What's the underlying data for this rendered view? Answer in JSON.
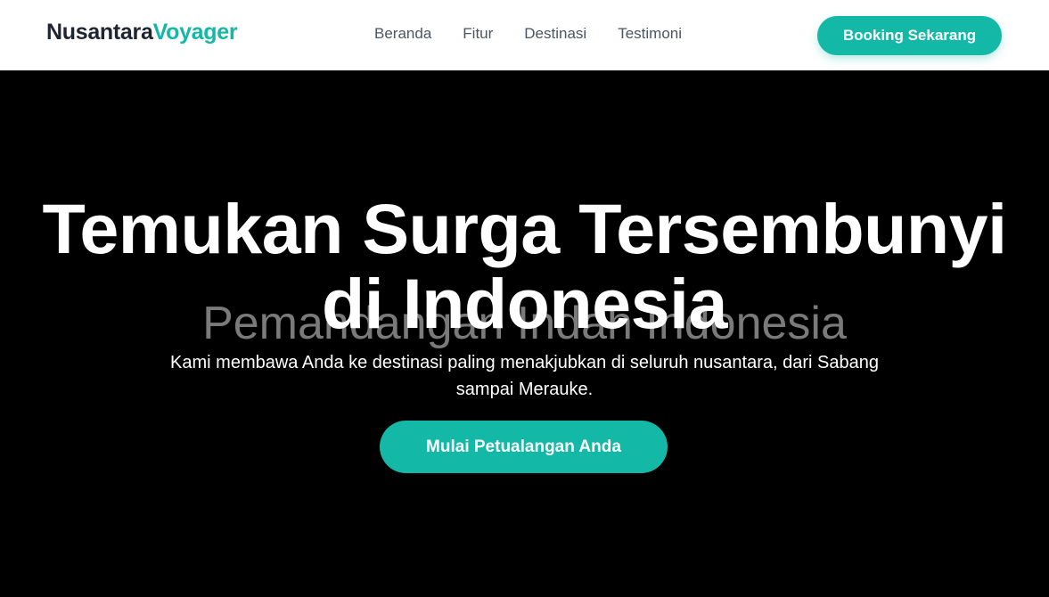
{
  "colors": {
    "accent": "#14b8a6",
    "logo_dark": "#1f2433",
    "nav_text": "#4b5563",
    "hero_bg": "#000000"
  },
  "navbar": {
    "logo_part1": "Nusantara",
    "logo_part2": "Voyager",
    "links": [
      "Beranda",
      "Fitur",
      "Destinasi",
      "Testimoni"
    ],
    "cta_label": "Booking Sekarang"
  },
  "hero": {
    "background_alt_text": "Pemandangan Indah Indonesia",
    "title_line1": "Temukan Surga Tersembunyi",
    "title_line2": "di Indonesia",
    "subtitle": "Kami membawa Anda ke destinasi paling menakjubkan di seluruh nusantara, dari Sabang sampai Merauke.",
    "cta_label": "Mulai Petualangan Anda"
  }
}
